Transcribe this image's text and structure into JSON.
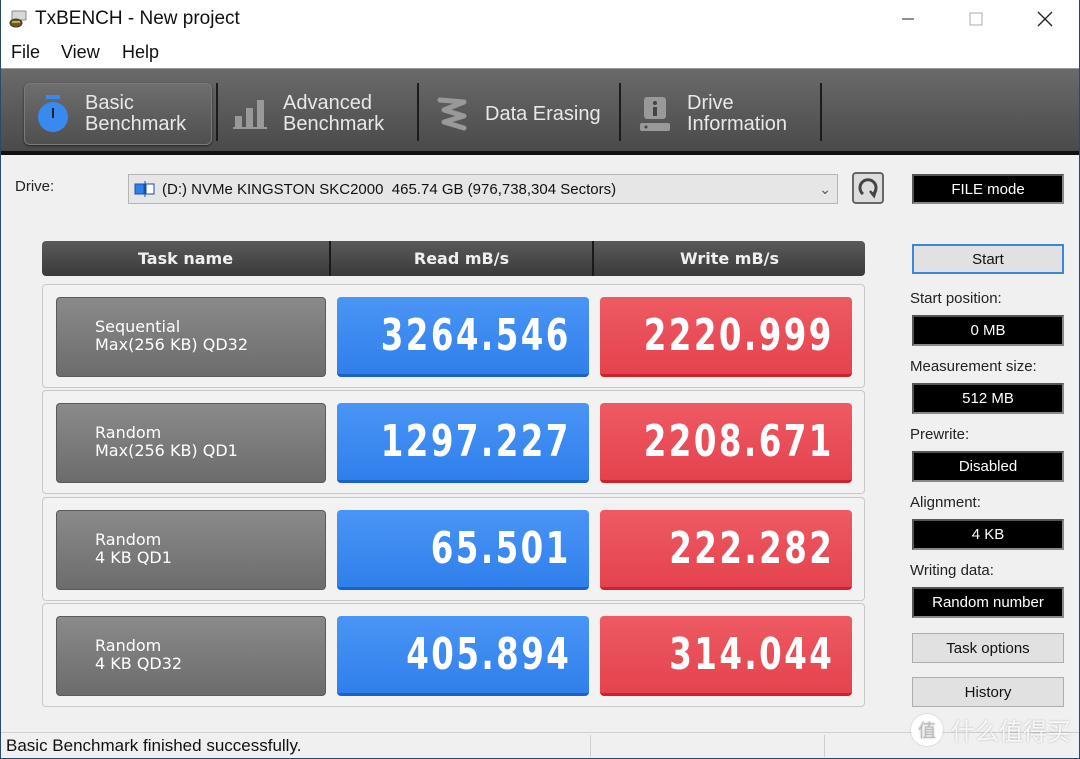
{
  "window": {
    "title": "TxBENCH - New project",
    "controls": {
      "minimize": "—",
      "maximize": "☐",
      "close": "✕"
    }
  },
  "menu": [
    "File",
    "View",
    "Help"
  ],
  "tabs": [
    {
      "line1": "Basic",
      "line2": "Benchmark",
      "icon": "stopwatch-icon",
      "active": true
    },
    {
      "line1": "Advanced",
      "line2": "Benchmark",
      "icon": "bar-chart-icon",
      "active": false
    },
    {
      "line1": "Data Erasing",
      "line2": "",
      "icon": "eraser-icon",
      "active": false
    },
    {
      "line1": "Drive",
      "line2": "Information",
      "icon": "drive-info-icon",
      "active": false
    }
  ],
  "drive": {
    "label": "Drive:",
    "selected": "(D:) NVMe KINGSTON SKC2000  465.74 GB (976,738,304 Sectors)",
    "mode": "FILE mode"
  },
  "table": {
    "headers": [
      "Task name",
      "Read mB/s",
      "Write mB/s"
    ],
    "rows": [
      {
        "task_line1": "Sequential",
        "task_line2": "Max(256 KB) QD32",
        "read": "3264.546",
        "write": "2220.999"
      },
      {
        "task_line1": "Random",
        "task_line2": "Max(256 KB) QD1",
        "read": "1297.227",
        "write": "2208.671"
      },
      {
        "task_line1": "Random",
        "task_line2": "4 KB QD1",
        "read": "65.501",
        "write": "222.282"
      },
      {
        "task_line1": "Random",
        "task_line2": "4 KB QD32",
        "read": "405.894",
        "write": "314.044"
      }
    ]
  },
  "settings": {
    "start_button": "Start",
    "start_position": {
      "label": "Start position:",
      "value": "0 MB"
    },
    "measurement_size": {
      "label": "Measurement size:",
      "value": "512 MB"
    },
    "prewrite": {
      "label": "Prewrite:",
      "value": "Disabled"
    },
    "alignment": {
      "label": "Alignment:",
      "value": "4 KB"
    },
    "writing_data": {
      "label": "Writing data:",
      "value": "Random number"
    },
    "task_options_button": "Task options",
    "history_button": "History"
  },
  "status": {
    "message": "Basic Benchmark finished successfully."
  },
  "watermark": {
    "glyph": "值",
    "text": "什么值得买"
  },
  "colors": {
    "read": "#3a89f0",
    "write": "#e84c55",
    "toolbar": "#5a5a5a",
    "accent": "#3a86d8"
  }
}
